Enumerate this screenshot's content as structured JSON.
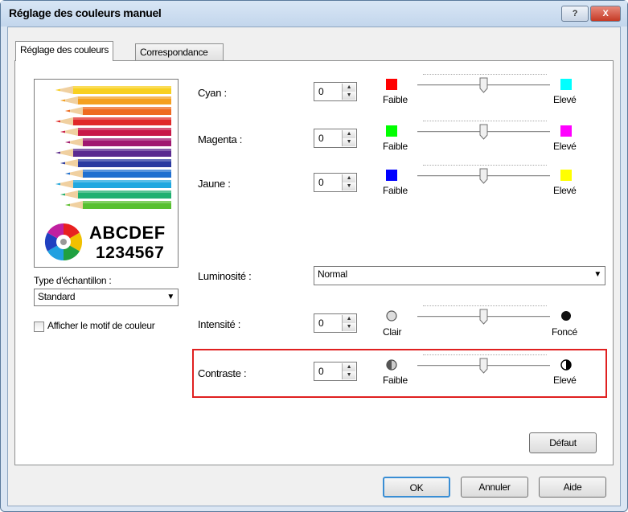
{
  "window": {
    "title": "Réglage des couleurs manuel",
    "help_label": "?",
    "close_label": "X"
  },
  "tabs": [
    {
      "label": "Réglage des couleurs",
      "selected": true
    },
    {
      "label": "Correspondance",
      "selected": false
    }
  ],
  "preview": {
    "line1": "ABCDEF",
    "line2": "1234567"
  },
  "sample_type": {
    "label": "Type d'échantillon :",
    "value": "Standard"
  },
  "show_pattern": {
    "label": "Afficher le motif de couleur",
    "checked": false
  },
  "sliders": [
    {
      "label": "Cyan :",
      "value": "0",
      "low_label": "Faible",
      "high_label": "Elevé",
      "low_color": "#ff0000",
      "high_color": "#00ffff",
      "level": 0.5
    },
    {
      "label": "Magenta :",
      "value": "0",
      "low_label": "Faible",
      "high_label": "Elevé",
      "low_color": "#00ff00",
      "high_color": "#ff00ff",
      "level": 0.5
    },
    {
      "label": "Jaune :",
      "value": "0",
      "low_label": "Faible",
      "high_label": "Elevé",
      "low_color": "#0000ff",
      "high_color": "#ffff00",
      "level": 0.5
    }
  ],
  "brightness": {
    "label": "Luminosité :",
    "value": "Normal"
  },
  "intensity": {
    "label": "Intensité :",
    "value": "0",
    "low_label": "Clair",
    "high_label": "Foncé",
    "low_icon": "light-circle-icon",
    "high_icon": "dark-circle-icon",
    "level": 0.5
  },
  "contrast": {
    "label": "Contraste :",
    "value": "0",
    "low_label": "Faible",
    "high_label": "Elevé",
    "low_icon": "contrast-low-icon",
    "high_icon": "contrast-high-icon",
    "level": 0.5,
    "highlight_color": "#e02020"
  },
  "buttons": {
    "default": "Défaut",
    "ok": "OK",
    "cancel": "Annuler",
    "help": "Aide"
  }
}
